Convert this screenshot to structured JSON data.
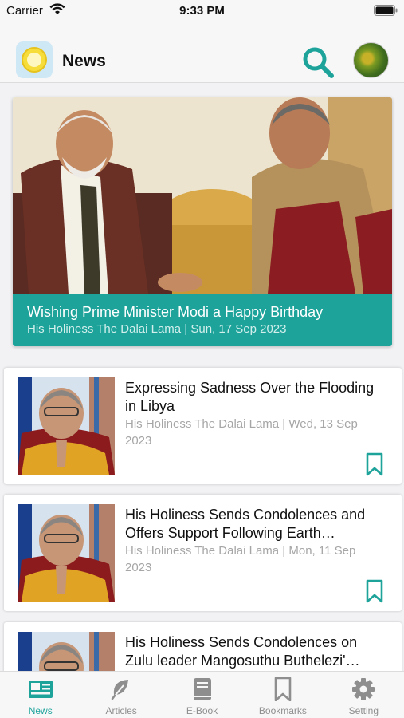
{
  "status_bar": {
    "carrier": "Carrier",
    "time": "9:33 PM"
  },
  "header": {
    "title": "News",
    "logo_icon": "app-logo-icon",
    "search_icon": "search-icon",
    "avatar_icon": "profile-avatar"
  },
  "colors": {
    "accent": "#1ea39b",
    "meta_text": "#a6a6a6",
    "tab_inactive": "#8e8e8e"
  },
  "featured": {
    "title": "Wishing Prime Minister Modi a Happy Birthday",
    "meta": "His Holiness The Dalai Lama | Sun, 17 Sep 2023"
  },
  "articles": [
    {
      "title": "Expressing Sadness Over the Flooding in Libya",
      "meta": "His Holiness The Dalai Lama | Wed, 13 Sep 2023"
    },
    {
      "title": "His Holiness Sends Condolences and Offers Support Following Earth…",
      "meta": "His Holiness The Dalai Lama | Mon, 11 Sep 2023"
    },
    {
      "title": "His Holiness Sends Condolences on Zulu leader Mangosuthu Buthelezi'…",
      "meta": ""
    }
  ],
  "tabs": [
    {
      "label": "News",
      "icon": "newspaper-icon",
      "active": true
    },
    {
      "label": "Articles",
      "icon": "leaf-icon",
      "active": false
    },
    {
      "label": "E-Book",
      "icon": "book-icon",
      "active": false
    },
    {
      "label": "Bookmarks",
      "icon": "bookmark-icon",
      "active": false
    },
    {
      "label": "Setting",
      "icon": "gear-icon",
      "active": false
    }
  ]
}
